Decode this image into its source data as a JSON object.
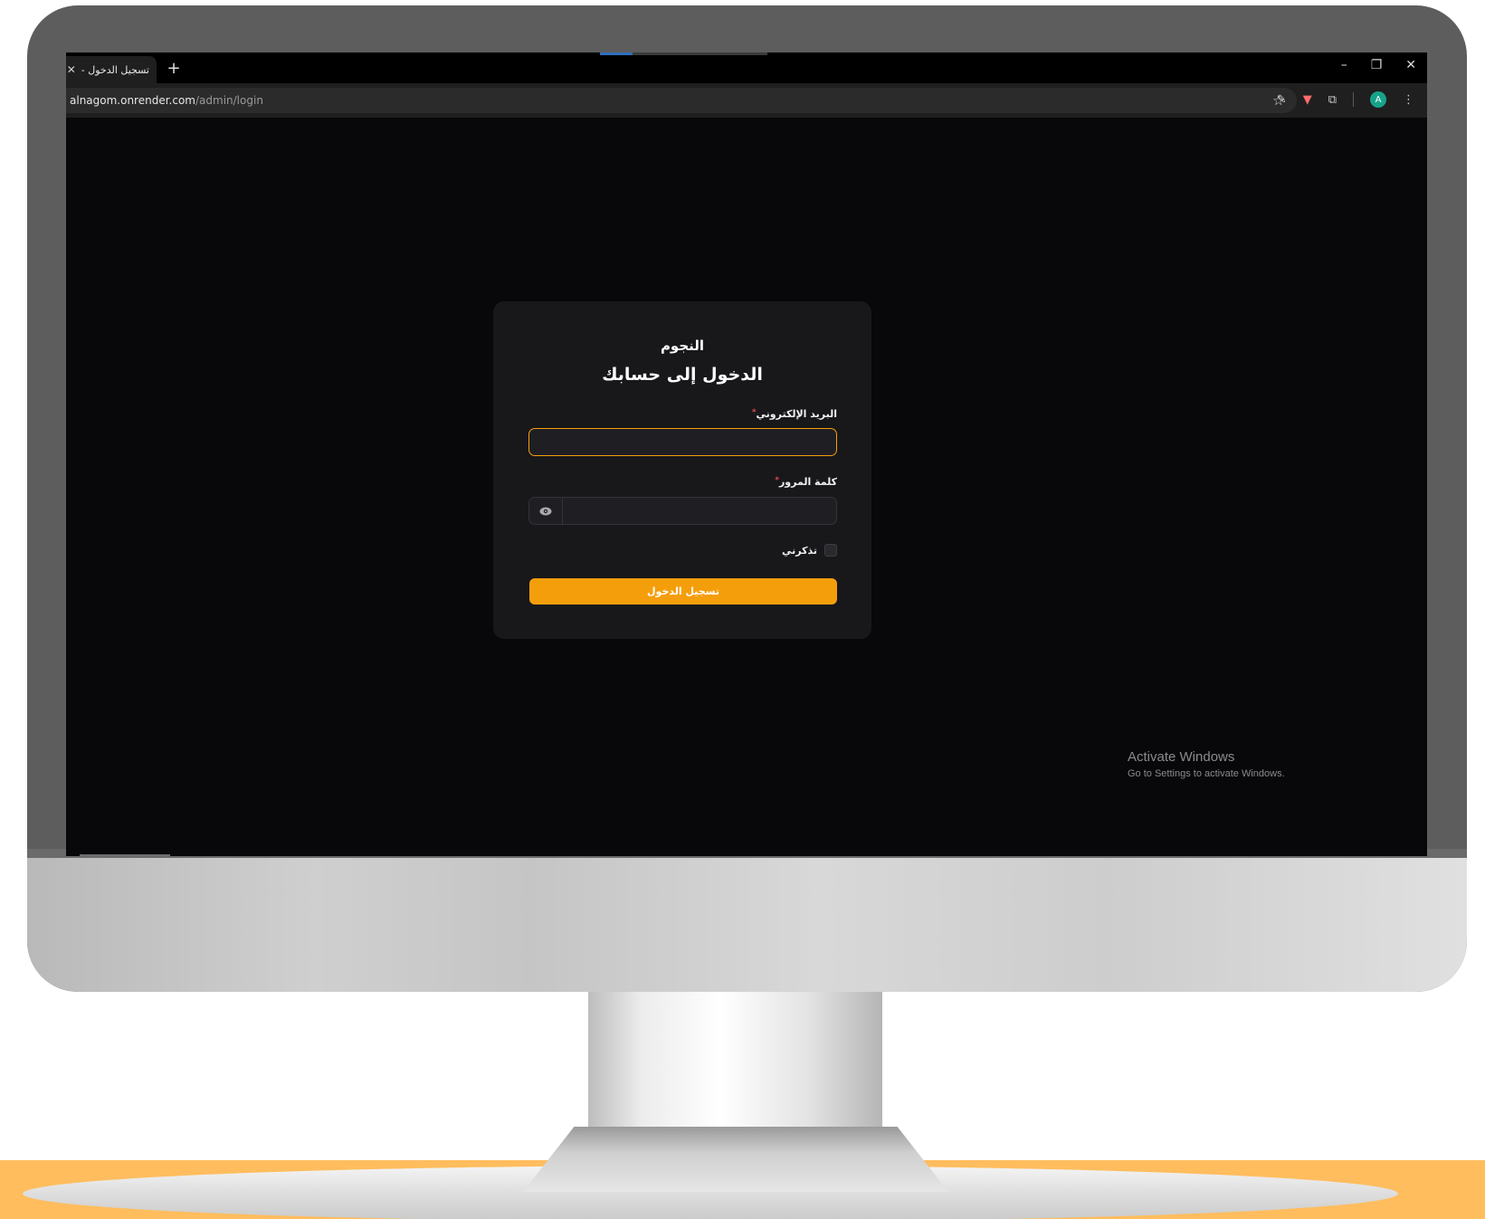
{
  "browser": {
    "tab_title": "تسجيل الدخول -",
    "tab_close": "✕",
    "new_tab": "+",
    "window_controls": {
      "minimize": "–",
      "restore": "❐",
      "close": "✕"
    },
    "url_host": "alnagom.onrender.com",
    "url_path": "/admin/login",
    "avatar_letter": "A"
  },
  "login": {
    "brand": "النجوم",
    "heading": "الدخول إلى حسابك",
    "email_label": "البريد الإلكتروني",
    "email_value": "",
    "password_label": "كلمة المرور",
    "password_value": "",
    "required_mark": "*",
    "remember_label": "تذكرني",
    "remember_checked": false,
    "submit_label": "تسجيل الدخول"
  },
  "watermark": {
    "line1": "Activate Windows",
    "line2": "Go to Settings to activate Windows."
  },
  "colors": {
    "accent": "#f59e0b",
    "page_bg": "#08080b",
    "card_bg": "#18181b",
    "floor": "#ffbd5e"
  }
}
